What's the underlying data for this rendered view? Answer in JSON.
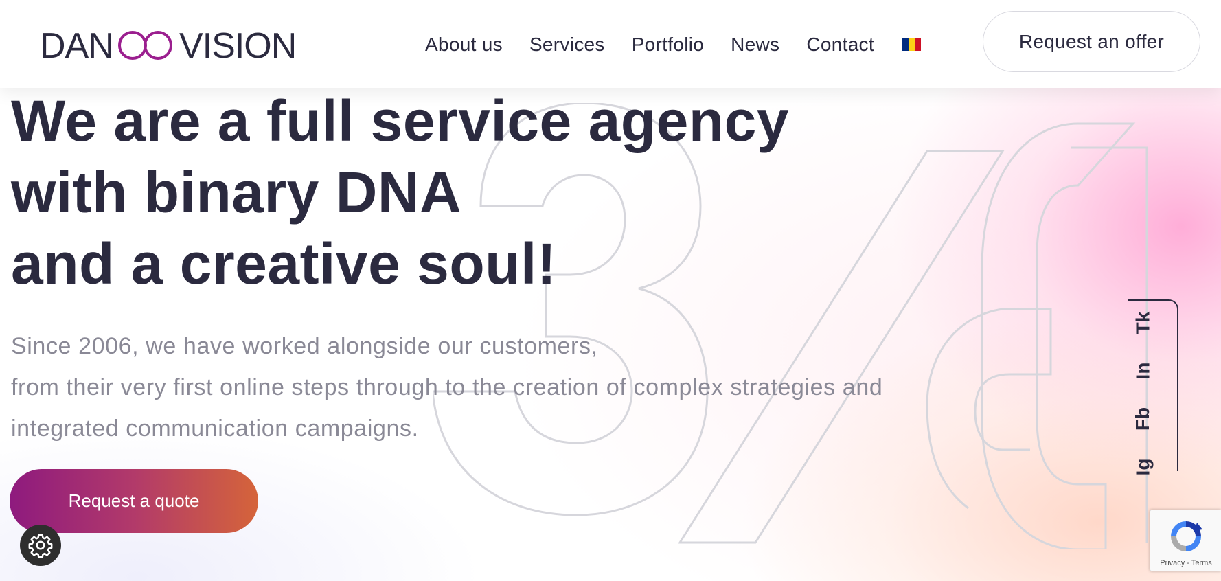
{
  "brand": {
    "logo_text_left": "DAN",
    "logo_text_right": "VISION",
    "logo_accent_color": "#9b1f8f",
    "text_color": "#2b2a3f"
  },
  "nav": {
    "items": [
      {
        "label": "About us"
      },
      {
        "label": "Services"
      },
      {
        "label": "Portfolio"
      },
      {
        "label": "News"
      },
      {
        "label": "Contact"
      }
    ],
    "language_flag": {
      "icon": "romania-flag-icon",
      "colors": [
        "#002b7f",
        "#fcd116",
        "#ce1126"
      ]
    },
    "offer_button": "Request an offer"
  },
  "hero": {
    "headline": [
      "We are a full service agency",
      "with binary DNA",
      "and a creative soul!"
    ],
    "subtext": [
      "Since 2006, we have worked alongside our customers,",
      "from their very first online steps through to the creation of complex strategies and",
      "integrated communication campaigns."
    ],
    "cta_button": "Request a quote",
    "cta_gradient": [
      "#8e1a7e",
      "#d5643a"
    ],
    "background_graphic": "360"
  },
  "social": {
    "links": [
      {
        "label": "Tk"
      },
      {
        "label": "In"
      },
      {
        "label": "Fb"
      },
      {
        "label": "Ig"
      }
    ]
  },
  "cookie": {
    "icon": "gear-icon"
  },
  "recaptcha": {
    "privacy": "Privacy",
    "separator": " - ",
    "terms": "Terms"
  }
}
